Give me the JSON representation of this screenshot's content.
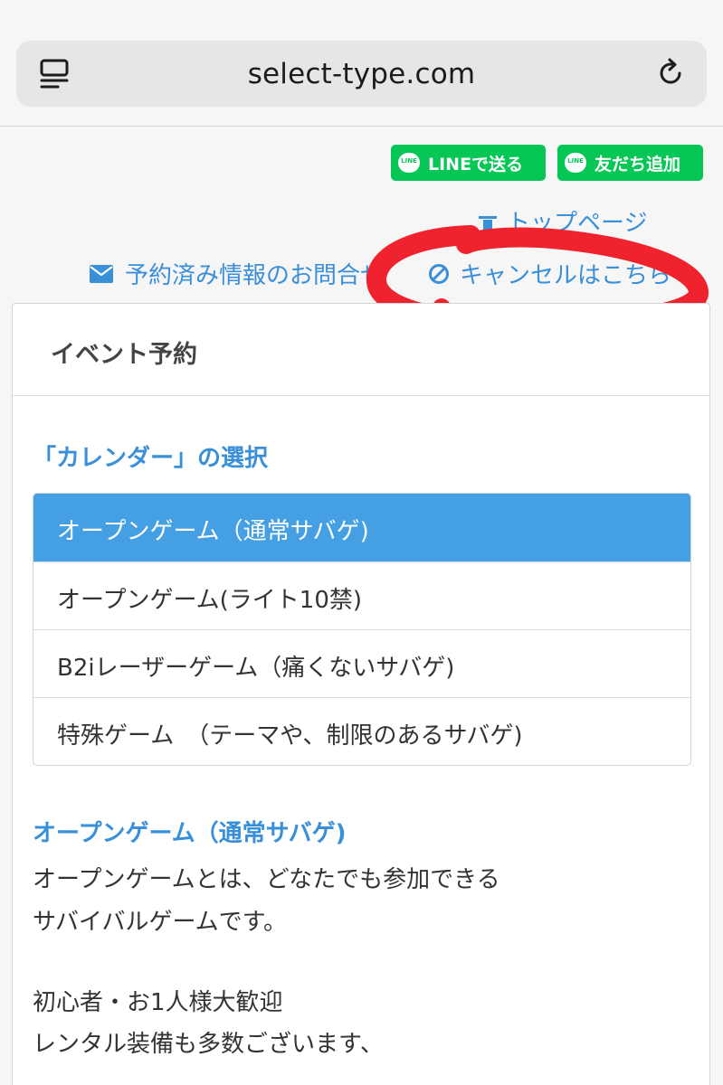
{
  "browser": {
    "url": "select-type.com"
  },
  "share": {
    "line_send_label": "LINEで送る",
    "line_add_label": "友だち追加",
    "line_logo_text": "LINE",
    "brand_color": "#06c755"
  },
  "links": {
    "top_page_label": "トップページ",
    "inquiry_label": "予約済み情報のお問合せ",
    "cancel_label": "キャンセルはこちら",
    "link_color": "#3a8fd9"
  },
  "annotation": {
    "marker_color": "#f0222e"
  },
  "card": {
    "title": "イベント予約",
    "calendar_heading": "「カレンダー」の選択",
    "calendars": [
      {
        "label": "オープンゲーム（通常サバゲ)",
        "selected": true
      },
      {
        "label": "オープンゲーム(ライト10禁)",
        "selected": false
      },
      {
        "label": "B2iレーザーゲーム（痛くないサバゲ)",
        "selected": false
      },
      {
        "label": "特殊ゲーム　（テーマや、制限のあるサバゲ)",
        "selected": false
      }
    ],
    "selected_color": "#449fe3",
    "description_title": "オープンゲーム（通常サバゲ)",
    "description_lines": [
      "オープンゲームとは、どなたでも参加できる",
      "サバイバルゲームです。",
      "",
      "初心者・お1人様大歓迎",
      "レンタル装備も多数ございます、"
    ]
  }
}
